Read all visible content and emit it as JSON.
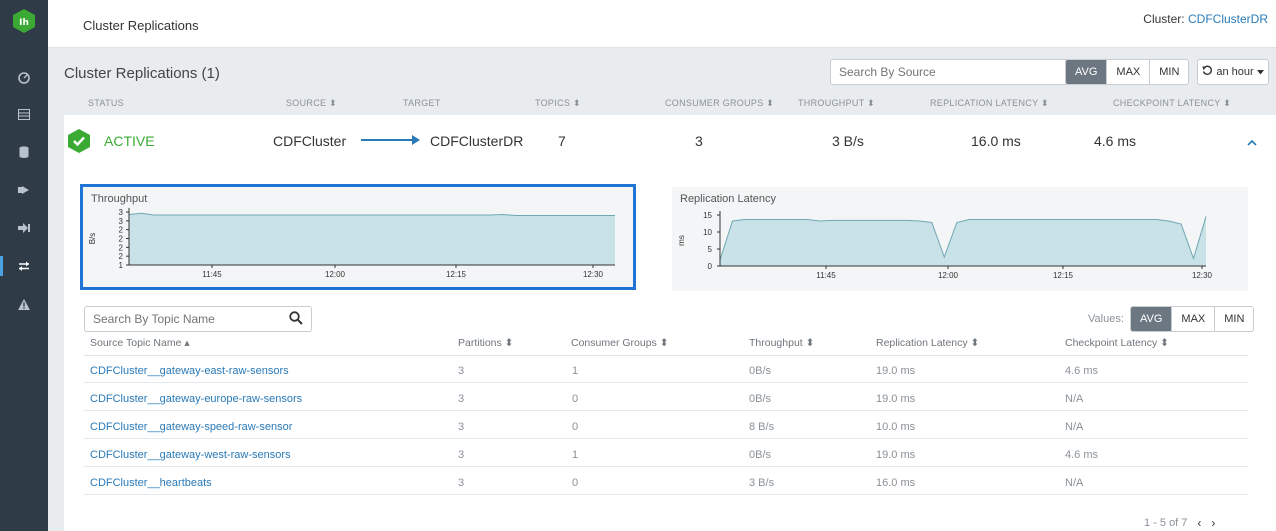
{
  "topbar": {
    "title": "Cluster Replications",
    "cluster_label": "Cluster: ",
    "cluster_name": "CDFClusterDR"
  },
  "header": {
    "title": "Cluster Replications (1)",
    "search_placeholder": "Search By Source",
    "mode_buttons": [
      "AVG",
      "MAX",
      "MIN"
    ],
    "selected_mode": "AVG",
    "time_range": "an hour"
  },
  "columns": [
    "STATUS",
    "SOURCE ⬍",
    "TARGET",
    "TOPICS ⬍",
    "CONSUMER GROUPS ⬍",
    "THROUGHPUT ⬍",
    "REPLICATION LATENCY ⬍",
    "CHECKPOINT LATENCY ⬍"
  ],
  "replication": {
    "status": "ACTIVE",
    "source": "CDFCluster",
    "target": "CDFClusterDR",
    "topics": "7",
    "consumer_groups": "3",
    "throughput": "3 B/s",
    "replication_latency": "16.0 ms",
    "checkpoint_latency": "4.6 ms"
  },
  "chart_data": [
    {
      "type": "area",
      "title": "Throughput",
      "ylabel": "B/s",
      "xlabel": "",
      "x_ticks": [
        "11:45",
        "12:00",
        "12:15",
        "12:30"
      ],
      "y_ticks": [
        "1",
        "2",
        "2",
        "2",
        "2",
        "3",
        "3"
      ],
      "ylim": [
        1,
        3.1
      ],
      "series": [
        {
          "values": [
            3,
            3.05,
            2.98,
            2.98,
            2.98,
            2.98,
            2.98,
            2.98,
            2.98,
            2.98,
            2.98,
            2.98,
            2.98,
            2.98,
            2.98,
            2.98,
            2.98,
            2.98,
            2.98,
            2.98,
            2.98,
            2.98,
            2.98,
            2.98,
            2.98,
            2.98,
            2.98,
            2.98,
            2.98,
            2.98,
            3.0,
            2.96,
            2.96,
            2.96,
            2.96,
            2.96,
            2.96,
            2.96,
            2.96,
            2.96
          ]
        }
      ],
      "grid": false,
      "color": "#c8e2e7"
    },
    {
      "type": "area",
      "title": "Replication Latency",
      "ylabel": "ms",
      "xlabel": "",
      "x_ticks": [
        "11:45",
        "12:00",
        "12:15",
        "12:30"
      ],
      "y_ticks": [
        "0",
        "5",
        "10",
        "15"
      ],
      "ylim": [
        0,
        17
      ],
      "series": [
        {
          "values": [
            2,
            15,
            15.5,
            15.5,
            15.5,
            15.5,
            15.5,
            15.5,
            15,
            15.2,
            15.2,
            15.2,
            15.2,
            15.2,
            15.2,
            15.2,
            15,
            14.5,
            3,
            14.5,
            15.5,
            15.5,
            15.5,
            15.5,
            15.5,
            15.5,
            15.5,
            15.5,
            15.5,
            15.5,
            15.5,
            15.5,
            15.5,
            15.5,
            15.5,
            15.5,
            15,
            14,
            2.5,
            16.5
          ]
        }
      ],
      "grid": false,
      "color": "#c8e2e7"
    }
  ],
  "topic_table": {
    "search_placeholder": "Search By Topic Name",
    "values_label": "Values:",
    "value_buttons": [
      "AVG",
      "MAX",
      "MIN"
    ],
    "selected_value": "AVG",
    "headers": [
      "Source Topic Name ▴",
      "Partitions ⬍",
      "Consumer Groups ⬍",
      "Throughput ⬍",
      "Replication Latency ⬍",
      "Checkpoint Latency ⬍"
    ],
    "rows": [
      [
        "CDFCluster__gateway-east-raw-sensors",
        "3",
        "1",
        "0B/s",
        "19.0 ms",
        "4.6 ms"
      ],
      [
        "CDFCluster__gateway-europe-raw-sensors",
        "3",
        "0",
        "0B/s",
        "19.0 ms",
        "N/A"
      ],
      [
        "CDFCluster__gateway-speed-raw-sensor",
        "3",
        "0",
        "8 B/s",
        "10.0 ms",
        "N/A"
      ],
      [
        "CDFCluster__gateway-west-raw-sensors",
        "3",
        "1",
        "0B/s",
        "19.0 ms",
        "4.6 ms"
      ],
      [
        "CDFCluster__heartbeats",
        "3",
        "0",
        "3 B/s",
        "16.0 ms",
        "N/A"
      ]
    ],
    "pager": "1 - 5 of 7",
    "prev": "‹",
    "next": "›"
  },
  "icons": {
    "logo": "smm-logo-icon",
    "mag": "search-icon",
    "refresh": "refresh-icon",
    "caret": "caret-down-icon"
  },
  "colors": {
    "accent": "#2a7ab8",
    "active": "#3aaa35",
    "sidebar": "#2f3b46",
    "selection": "#1f74d4"
  }
}
